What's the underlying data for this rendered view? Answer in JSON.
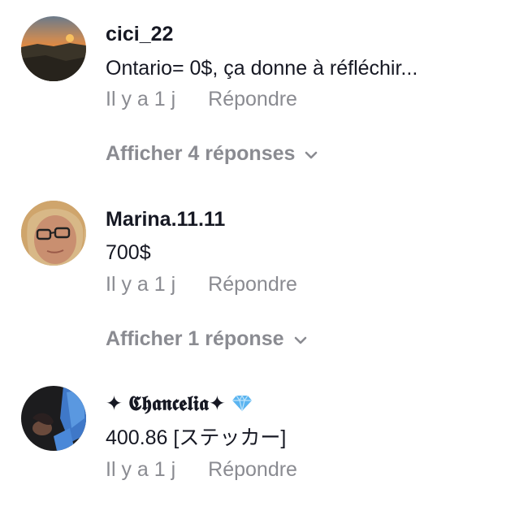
{
  "comments": [
    {
      "username": "cici_22",
      "text": "Ontario= 0$, ça donne à réfléchir...",
      "time": "Il y a 1 j",
      "reply_label": "Répondre",
      "show_replies_label": "Afficher 4 réponses"
    },
    {
      "username": "Marina.11.11",
      "text": "700$",
      "time": "Il y a 1 j",
      "reply_label": "Répondre",
      "show_replies_label": "Afficher 1 réponse"
    },
    {
      "username": "✦ 𝕮𝖍𝖆𝖓𝖈𝖊𝖑𝖎𝖆✦",
      "username_badge_icon": "diamond-icon",
      "text": "400.86 [ステッカー]",
      "time": "Il y a 1 j",
      "reply_label": "Répondre"
    }
  ],
  "colors": {
    "primary_text": "#161823",
    "secondary_text": "#8a8b91",
    "diamond": "#5ab4f0"
  },
  "icons": {
    "expand": "chevron-down-icon"
  }
}
